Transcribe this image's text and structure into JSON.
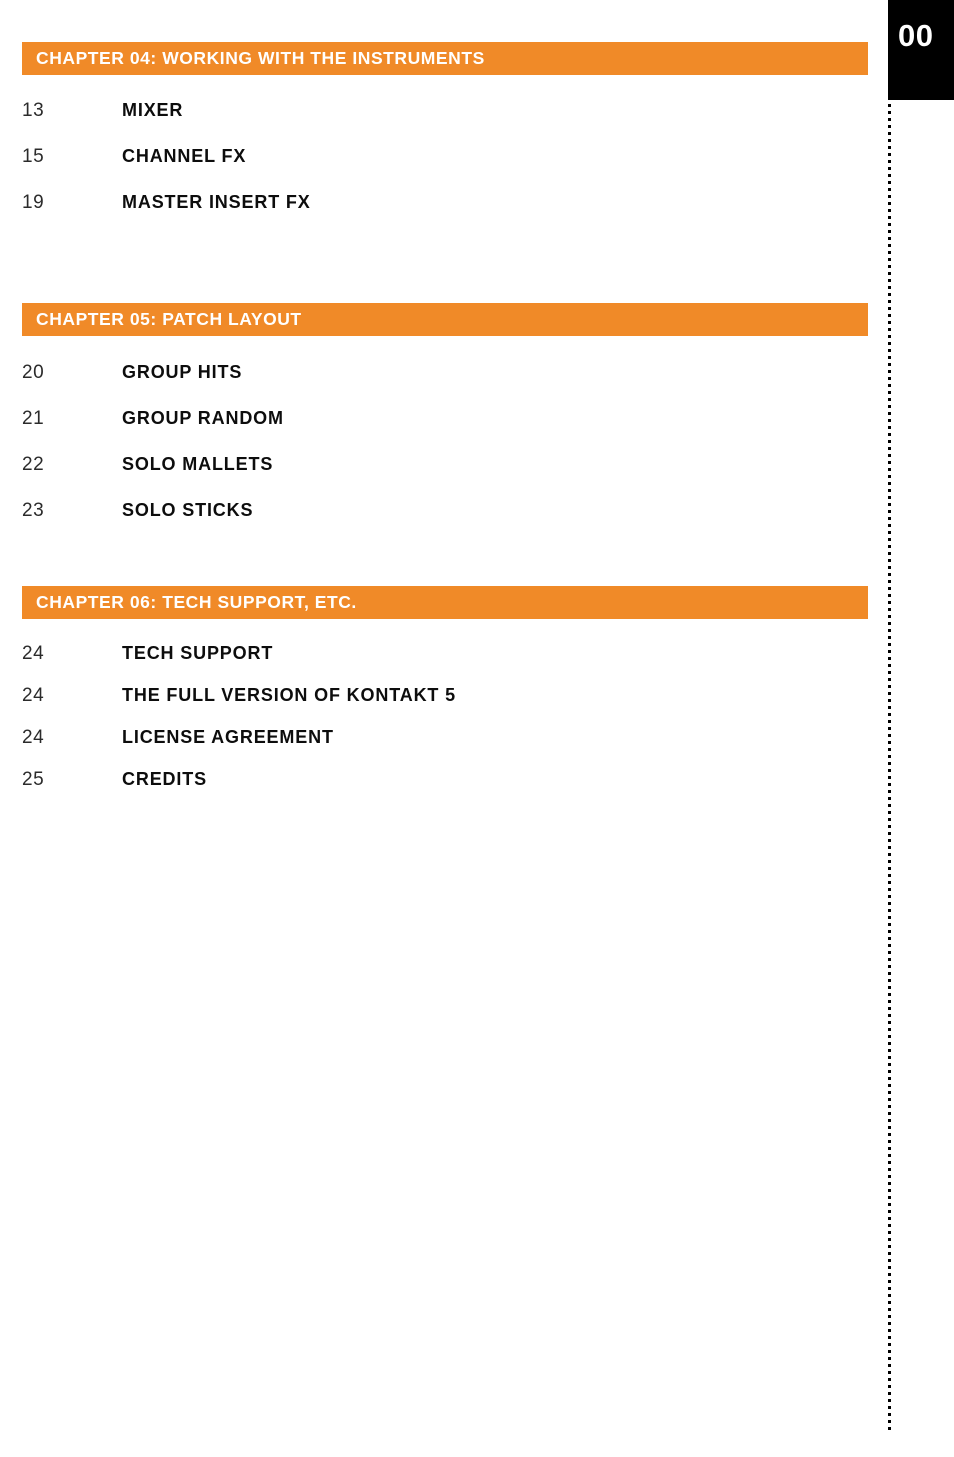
{
  "page": {
    "number": "00",
    "accent_color": "#f08a28",
    "page_number_block_color": "#000000",
    "page_number_text_color": "#ffffff",
    "body_background": "#ffffff"
  },
  "sections": [
    {
      "chapter_title": "CHAPTER 04: WORKING WITH THE INSTRUMENTS",
      "entries": [
        {
          "page": "13",
          "name": "MIXER"
        },
        {
          "page": "15",
          "name": "CHANNEL FX"
        },
        {
          "page": "19",
          "name": "MASTER INSERT FX"
        }
      ]
    },
    {
      "chapter_title": "CHAPTER 05: PATCH LAYOUT",
      "entries": [
        {
          "page": "20",
          "name": "GROUP HITS"
        },
        {
          "page": "21",
          "name": "GROUP RANDOM"
        },
        {
          "page": "22",
          "name": "SOLO MALLETS"
        },
        {
          "page": "23",
          "name": "SOLO STICKS"
        }
      ]
    },
    {
      "chapter_title": "CHAPTER 06: TECH SUPPORT, ETC.",
      "entries": [
        {
          "page": "24",
          "name": "TECH SUPPORT"
        },
        {
          "page": "24",
          "name": "THE FULL VERSION OF KONTAKT 5"
        },
        {
          "page": "24",
          "name": "LICENSE AGREEMENT"
        },
        {
          "page": "25",
          "name": "CREDITS"
        }
      ]
    }
  ]
}
